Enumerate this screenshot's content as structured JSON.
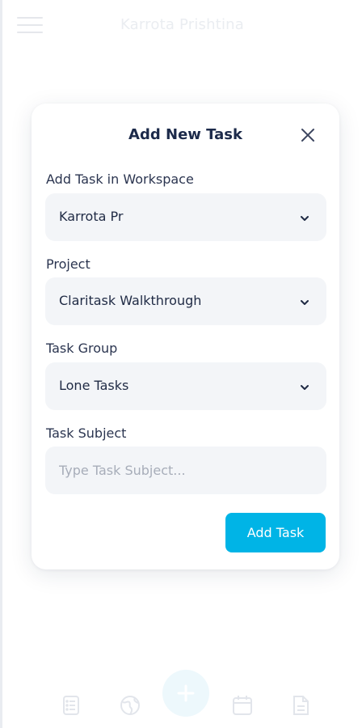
{
  "header": {
    "workspace_title": "Karrota Prishtina",
    "menu_icon": "hamburger-menu-icon"
  },
  "modal": {
    "title": "Add New Task",
    "close_icon": "close-icon",
    "fields": {
      "workspace": {
        "label": "Add Task in Workspace",
        "value": "Karrota Pr"
      },
      "project": {
        "label": "Project",
        "value": "Claritask Walkthrough"
      },
      "task_group": {
        "label": "Task Group",
        "value": "Lone Tasks"
      },
      "task_subject": {
        "label": "Task Subject",
        "value": "",
        "placeholder": "Type Task Subject..."
      }
    },
    "submit_label": "Add Task"
  },
  "bottom_nav": {
    "items": [
      "tasks-list-icon",
      "globe-icon",
      "add-icon",
      "calendar-icon",
      "document-icon"
    ]
  },
  "colors": {
    "accent": "#00b4e6",
    "field_bg": "#f3f5f8",
    "title_text": "#1c2a4a",
    "faded_ui": "#dfe3ea"
  }
}
